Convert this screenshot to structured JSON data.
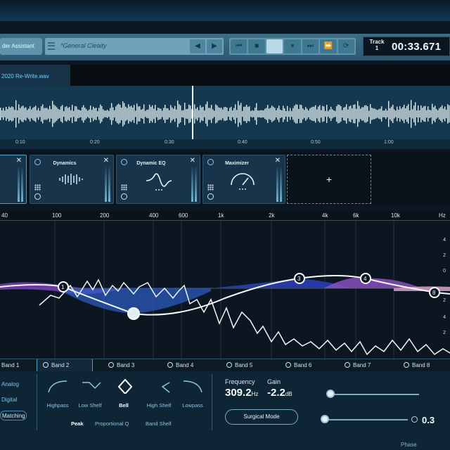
{
  "toolbar": {
    "assistant_label": "der Assistant",
    "preset_name": "*General Cleaity",
    "prev_preset": "◀",
    "next_preset": "▶",
    "transport_buttons": [
      "⏮",
      "■",
      "",
      "⏸",
      "⏭",
      "⏩",
      "⟳"
    ],
    "track_label": "Track 1",
    "time": "00:33.671"
  },
  "file": {
    "name": "2020 Re-Write.wav"
  },
  "timeline": {
    "ticks": [
      "0:10",
      "0:20",
      "0:30",
      "0:40",
      "0:50",
      "1:00"
    ]
  },
  "modules": [
    {
      "title": ""
    },
    {
      "title": "Dynamics"
    },
    {
      "title": "Dynamic EQ"
    },
    {
      "title": "Maximizer"
    }
  ],
  "add_module": "+",
  "eq": {
    "freq_ticks": [
      "40",
      "100",
      "200",
      "400",
      "600",
      "1k",
      "2k",
      "4k",
      "6k",
      "10k",
      "Hz"
    ],
    "db_ticks": [
      "4",
      "2",
      "0",
      "2",
      "4",
      "2"
    ],
    "nodes": [
      "1",
      "3",
      "4",
      "8"
    ]
  },
  "bands": [
    {
      "label": "Band 1"
    },
    {
      "label": "Band 2"
    },
    {
      "label": "Band 3"
    },
    {
      "label": "Band 4"
    },
    {
      "label": "Band 5"
    },
    {
      "label": "Band 6"
    },
    {
      "label": "Band 7"
    },
    {
      "label": "Band 8"
    }
  ],
  "modes": [
    "Analog",
    "Digital",
    "Matching"
  ],
  "shapes": [
    "Highpass",
    "Low Shelf",
    "Bell",
    "High Shelf",
    "Lowpass"
  ],
  "subshapes": [
    "Peak",
    "Proportional Q",
    "Band Shelf"
  ],
  "readout": {
    "frequency_label": "Frequency",
    "frequency_value": "309.2",
    "frequency_unit": "Hz",
    "gain_label": "Gain",
    "gain_value": "-2.2",
    "gain_unit": "dB"
  },
  "surgical_mode": "Surgical Mode",
  "q_value": "0.3",
  "phase_label": "Phase",
  "colors": {
    "accent": "#3aa6d8",
    "purple_band": "#8a4fc0",
    "blue_band": "#2f4fc8"
  }
}
